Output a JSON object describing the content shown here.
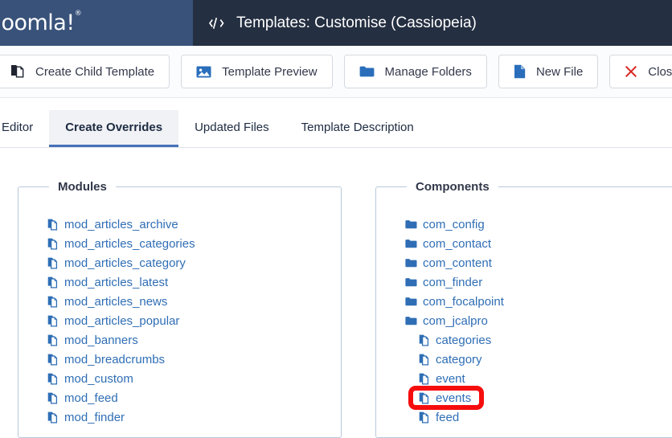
{
  "brand": {
    "logo_text": "Joomla!",
    "logo_mark": "®"
  },
  "header": {
    "icon": "code-icon",
    "title": "Templates: Customise (Cassiopeia)"
  },
  "toolbar": {
    "buttons": [
      {
        "label": "Create Child Template",
        "icon": "copy-icon",
        "icon_color": "#1f2430"
      },
      {
        "label": "Template Preview",
        "icon": "image-icon",
        "icon_color": "#2a6ebb"
      },
      {
        "label": "Manage Folders",
        "icon": "folder-icon",
        "icon_color": "#2a6ebb"
      },
      {
        "label": "New File",
        "icon": "file-icon",
        "icon_color": "#2a6ebb"
      },
      {
        "label": "Close",
        "icon": "close-x-icon",
        "icon_color": "#d9241f"
      }
    ]
  },
  "tabs": [
    {
      "label": "Editor",
      "active": false
    },
    {
      "label": "Create Overrides",
      "active": true
    },
    {
      "label": "Updated Files",
      "active": false
    },
    {
      "label": "Template Description",
      "active": false
    }
  ],
  "panels": {
    "modules": {
      "legend": "Modules",
      "items": [
        {
          "label": "mod_articles_archive",
          "icon": "copy-file-icon",
          "indent": false
        },
        {
          "label": "mod_articles_categories",
          "icon": "copy-file-icon",
          "indent": false
        },
        {
          "label": "mod_articles_category",
          "icon": "copy-file-icon",
          "indent": false
        },
        {
          "label": "mod_articles_latest",
          "icon": "copy-file-icon",
          "indent": false
        },
        {
          "label": "mod_articles_news",
          "icon": "copy-file-icon",
          "indent": false
        },
        {
          "label": "mod_articles_popular",
          "icon": "copy-file-icon",
          "indent": false
        },
        {
          "label": "mod_banners",
          "icon": "copy-file-icon",
          "indent": false
        },
        {
          "label": "mod_breadcrumbs",
          "icon": "copy-file-icon",
          "indent": false
        },
        {
          "label": "mod_custom",
          "icon": "copy-file-icon",
          "indent": false
        },
        {
          "label": "mod_feed",
          "icon": "copy-file-icon",
          "indent": false
        },
        {
          "label": "mod_finder",
          "icon": "copy-file-icon",
          "indent": false
        }
      ]
    },
    "components": {
      "legend": "Components",
      "items": [
        {
          "label": "com_config",
          "icon": "folder-icon",
          "indent": false
        },
        {
          "label": "com_contact",
          "icon": "folder-icon",
          "indent": false
        },
        {
          "label": "com_content",
          "icon": "folder-icon",
          "indent": false
        },
        {
          "label": "com_finder",
          "icon": "folder-icon",
          "indent": false
        },
        {
          "label": "com_focalpoint",
          "icon": "folder-icon",
          "indent": false
        },
        {
          "label": "com_jcalpro",
          "icon": "folder-icon",
          "indent": false
        },
        {
          "label": "categories",
          "icon": "copy-file-icon",
          "indent": true
        },
        {
          "label": "category",
          "icon": "copy-file-icon",
          "indent": true
        },
        {
          "label": "event",
          "icon": "copy-file-icon",
          "indent": true
        },
        {
          "label": "events",
          "icon": "copy-file-icon",
          "indent": true
        },
        {
          "label": "feed",
          "icon": "copy-file-icon",
          "indent": true
        }
      ]
    }
  },
  "annotation": {
    "target": "events",
    "color": "#f60d0d"
  },
  "colors": {
    "sidebar_bg": "#39527a",
    "header_bg": "#242f41",
    "link": "#2f6eb5",
    "accent": "#4571b8",
    "panel_border": "#b9c8db"
  }
}
